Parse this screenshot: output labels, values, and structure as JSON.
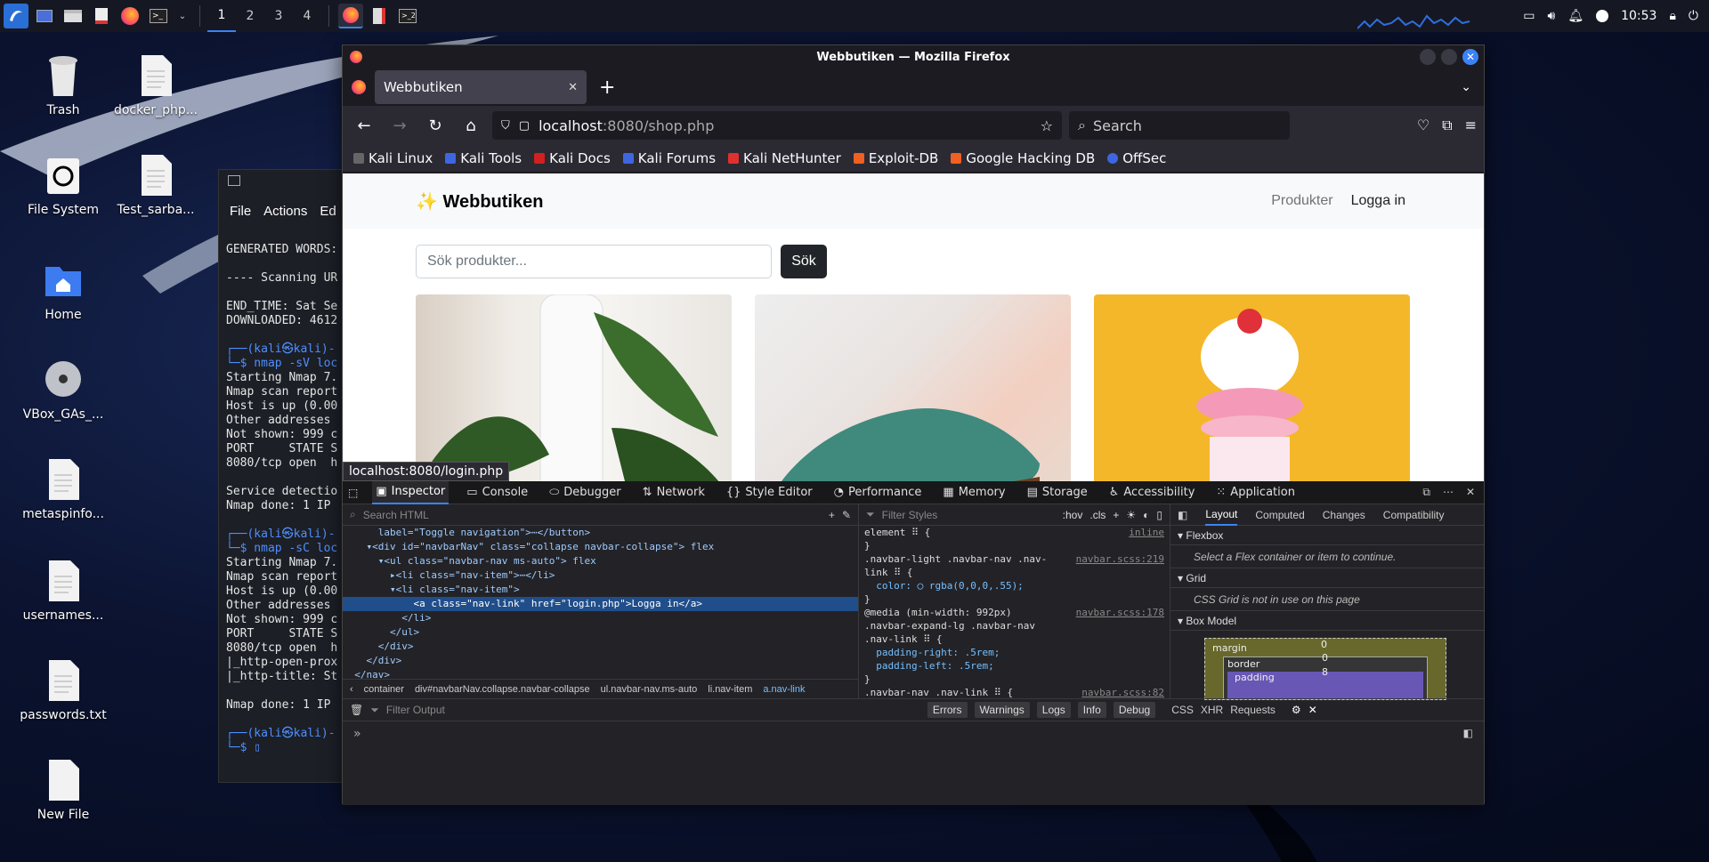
{
  "taskbar": {
    "workspaces": [
      "1",
      "2",
      "3",
      "4"
    ],
    "clock": "10:53"
  },
  "desktop": {
    "icons": [
      {
        "label": "Trash"
      },
      {
        "label": "docker_php..."
      },
      {
        "label": "File System"
      },
      {
        "label": "Test_sarba..."
      },
      {
        "label": "Home"
      },
      {
        "label": "VBox_GAs_..."
      },
      {
        "label": "metaspinfo..."
      },
      {
        "label": "usernames..."
      },
      {
        "label": "passwords.txt"
      },
      {
        "label": "New File"
      }
    ]
  },
  "terminal": {
    "menu": [
      "File",
      "Actions",
      "Ed"
    ],
    "lines": [
      "GENERATED WORDS:",
      "",
      "---- Scanning UR",
      "",
      "END_TIME: Sat Se",
      "DOWNLOADED: 4612",
      "",
      "┌──(kali㉿kali)-",
      "└─$ nmap -sV loc",
      "Starting Nmap 7.",
      "Nmap scan report",
      "Host is up (0.00",
      "Other addresses",
      "Not shown: 999 c",
      "PORT     STATE S",
      "8080/tcp open  h",
      "",
      "Service detectio",
      "Nmap done: 1 IP",
      "",
      "┌──(kali㉿kali)-",
      "└─$ nmap -sC loc",
      "Starting Nmap 7.",
      "Nmap scan report",
      "Host is up (0.00",
      "Other addresses",
      "Not shown: 999 c",
      "PORT     STATE S",
      "8080/tcp open  h",
      "|_http-open-prox",
      "|_http-title: St",
      "",
      "Nmap done: 1 IP",
      "",
      "┌──(kali㉿kali)-",
      "└─$ ▯"
    ]
  },
  "firefox": {
    "window_title": "Webbutiken — Mozilla Firefox",
    "tab_title": "Webbutiken",
    "url_host": "localhost",
    "url_rest": ":8080/shop.php",
    "search_placeholder": "Search",
    "bookmarks": [
      "Kali Linux",
      "Kali Tools",
      "Kali Docs",
      "Kali Forums",
      "Kali NetHunter",
      "Exploit-DB",
      "Google Hacking DB",
      "OffSec"
    ],
    "status_url": "localhost:8080/login.php"
  },
  "site": {
    "brand": "✨ Webbutiken",
    "nav_links": [
      "Produkter",
      "Logga in"
    ],
    "search_placeholder": "Sök produkter...",
    "search_button": "Sök"
  },
  "devtools": {
    "tabs": [
      "Inspector",
      "Console",
      "Debugger",
      "Network",
      "Style Editor",
      "Performance",
      "Memory",
      "Storage",
      "Accessibility",
      "Application"
    ],
    "search_html_placeholder": "Search HTML",
    "filter_styles_placeholder": "Filter Styles",
    "hov": ":hov",
    "cls": ".cls",
    "html_lines": [
      "      label=\"Toggle navigation\">⋯</button>",
      "    ▾<div id=\"navbarNav\" class=\"collapse navbar-collapse\"> flex",
      "      ▾<ul class=\"navbar-nav ms-auto\"> flex",
      "        ▸<li class=\"nav-item\">⋯</li>",
      "        ▾<li class=\"nav-item\">",
      "            <a class=\"nav-link\" href=\"login.php\">Logga in</a>",
      "          </li>",
      "        </ul>",
      "      </div>",
      "    </div>",
      "  </nav>"
    ],
    "breadcrumbs": [
      "container",
      "div#navbarNav.collapse.navbar-collapse",
      "ul.navbar-nav.ms-auto",
      "li.nav-item",
      "a.nav-link"
    ],
    "css_rules": [
      {
        "t": "element ⠿ {",
        "src": "inline"
      },
      {
        "t": "}",
        "src": ""
      },
      {
        "t": ".navbar-light .navbar-nav .nav-",
        "src": "navbar.scss:219"
      },
      {
        "t": "link ⠿ {",
        "src": ""
      },
      {
        "t": "  color: ◯ rgba(0,0,0,.55);",
        "src": ""
      },
      {
        "t": "}",
        "src": ""
      },
      {
        "t": "@media (min-width: 992px)",
        "src": "navbar.scss:178"
      },
      {
        "t": ".navbar-expand-lg .navbar-nav",
        "src": ""
      },
      {
        "t": ".nav-link ⠿ {",
        "src": ""
      },
      {
        "t": "  padding-right: .5rem;",
        "src": ""
      },
      {
        "t": "  padding-left: .5rem;",
        "src": ""
      },
      {
        "t": "}",
        "src": ""
      },
      {
        "t": ".navbar-nav .nav-link ⠿ {",
        "src": "navbar.scss:82"
      }
    ],
    "layout_tabs": [
      "Layout",
      "Computed",
      "Changes",
      "Compatibility"
    ],
    "flexbox_title": "Flexbox",
    "flexbox_msg": "Select a Flex container or item to continue.",
    "grid_title": "Grid",
    "grid_msg": "CSS Grid is not in use on this page",
    "boxmodel_title": "Box Model",
    "box_labels": [
      "margin",
      "border",
      "padding"
    ],
    "box_values": [
      "0",
      "0",
      "8"
    ],
    "console_filter_placeholder": "Filter Output",
    "console_filters": [
      "Errors",
      "Warnings",
      "Logs",
      "Info",
      "Debug",
      "CSS",
      "XHR",
      "Requests"
    ],
    "console_prompt": "»"
  }
}
